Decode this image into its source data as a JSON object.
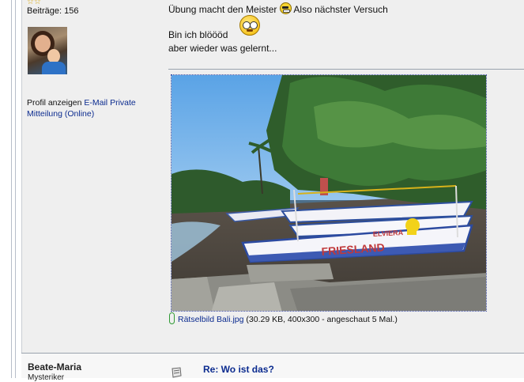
{
  "post": {
    "posts_label": "Beiträge: 156",
    "stars": "☆☆",
    "profile_link": "Profil anzeigen",
    "email_link": "E-Mail",
    "pm_link": "Private Mitteilung",
    "status": "(Online)",
    "message": {
      "line1_a": "Übung macht den Meister",
      "line1_b": "Also nächster Versuch",
      "line2": "Bin ich blöööd",
      "line3": "aber wieder was gelernt..."
    },
    "attachment": {
      "filename": "Rätselbild Bali.jpg",
      "info": "(30.29 KB, 400x300 - angeschaut 5 Mal.)"
    }
  },
  "next_post": {
    "author": "Beate-Maria",
    "rank": "Mysteriker",
    "subject": "Re: Wo ist das?"
  },
  "photo_boat_label": "FRIESLAND",
  "photo_boat_label_small": "ELVIERA"
}
